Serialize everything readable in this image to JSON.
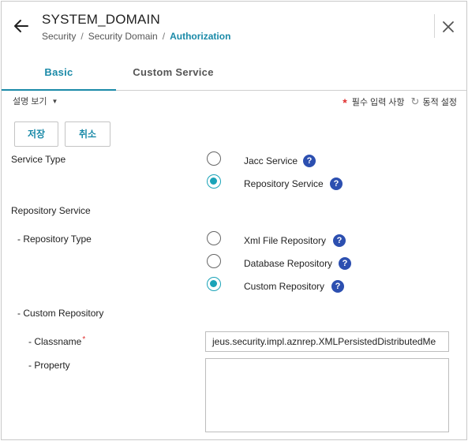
{
  "header": {
    "title": "SYSTEM_DOMAIN",
    "breadcrumb": [
      "Security",
      "Security Domain",
      "Authorization"
    ],
    "breadcrumb_separator": "/"
  },
  "tabs": [
    {
      "label": "Basic",
      "active": true
    },
    {
      "label": "Custom Service",
      "active": false
    }
  ],
  "toolbar": {
    "description_toggle": "설명 보기",
    "required_star": "*",
    "required_label": "필수 입력 사항",
    "dynamic_icon": "refresh-icon",
    "dynamic_label": "동적 설정"
  },
  "buttons": {
    "save": "저장",
    "cancel": "취소"
  },
  "form": {
    "service_type": {
      "label": "Service Type",
      "options": [
        {
          "label": "Jacc Service",
          "checked": false
        },
        {
          "label": "Repository Service",
          "checked": true
        }
      ]
    },
    "repository_service": {
      "label": "Repository Service"
    },
    "repository_type": {
      "label": "- Repository Type",
      "options": [
        {
          "label": "Xml File Repository",
          "checked": false
        },
        {
          "label": "Database Repository",
          "checked": false
        },
        {
          "label": "Custom Repository",
          "checked": true
        }
      ]
    },
    "custom_repository": {
      "label": "- Custom Repository"
    },
    "classname": {
      "label": "- Classname",
      "required_star": "*",
      "value": "jeus.security.impl.aznrep.XMLPersistedDistributedMe"
    },
    "property": {
      "label": "- Property",
      "value": ""
    }
  },
  "help_glyph": "?",
  "colors": {
    "accent": "#1a8aa8",
    "radio_checked": "#1aa3b8",
    "help_badge": "#2c4fb0",
    "required": "#e03030"
  }
}
